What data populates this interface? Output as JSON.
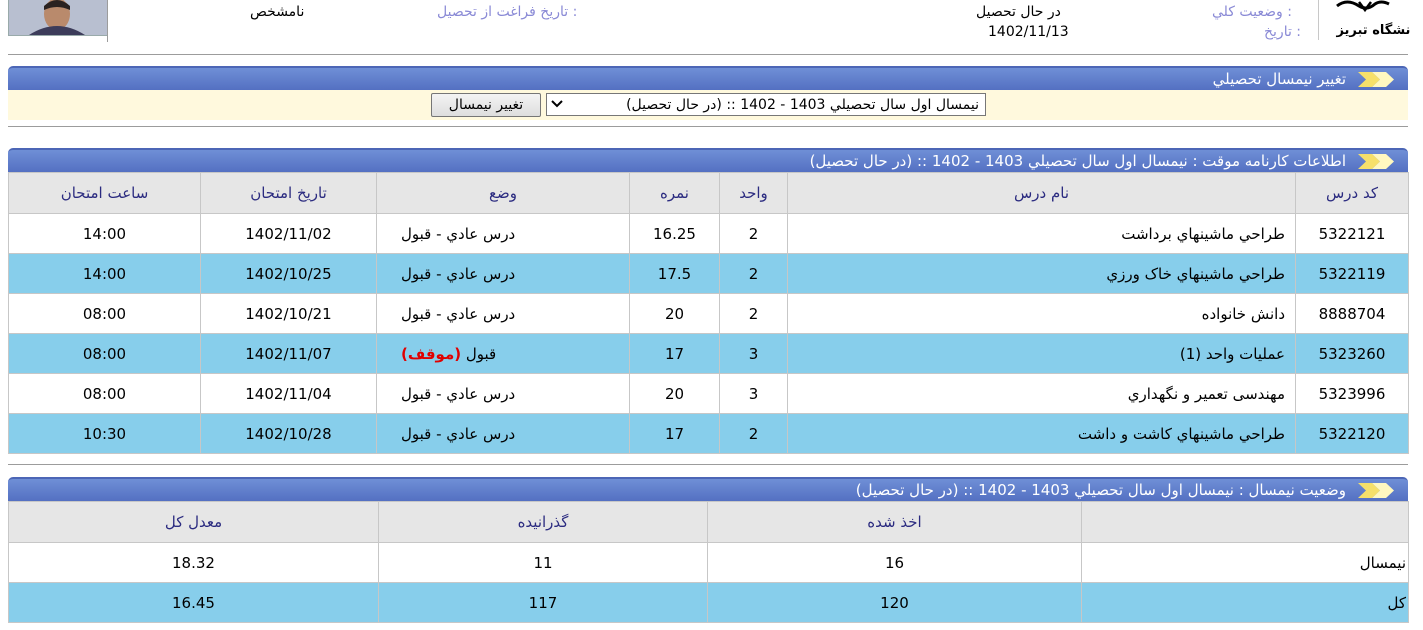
{
  "header": {
    "overall_status_label": "وضعيت کلي :",
    "overall_status_value": "در حال تحصيل",
    "date_label": "تاريخ :",
    "date_value": "1402/11/13",
    "graduation_label": "تاريخ فراغت از تحصيل :",
    "graduation_value": "نامشخص",
    "logo_text": "دانشگاه تبریز"
  },
  "semester_panel": {
    "title": "تغيير نيمسال تحصيلي",
    "selected_option": "نيمسال اول سال تحصيلي 1403 - 1402 :: (در حال تحصيل)",
    "change_button": "تغيير نيمسال"
  },
  "transcript": {
    "title": "اطلاعات کارنامه موقت : نيمسال اول سال تحصيلي 1403 - 1402 :: (در حال تحصيل)",
    "columns": [
      "کد درس",
      "نام درس",
      "واحد",
      "نمره",
      "وضع",
      "تاريخ امتحان",
      "ساعت امتحان"
    ],
    "rows": [
      {
        "code": "5322121",
        "name": "طراحي ماشينهاي برداشت",
        "units": "2",
        "grade": "16.25",
        "status": "درس عادي - قبول",
        "status_extra": "",
        "exam_date": "1402/11/02",
        "exam_time": "14:00"
      },
      {
        "code": "5322119",
        "name": "طراحي ماشينهاي خاک ورزي",
        "units": "2",
        "grade": "17.5",
        "status": "درس عادي - قبول",
        "status_extra": "",
        "exam_date": "1402/10/25",
        "exam_time": "14:00"
      },
      {
        "code": "8888704",
        "name": "دانش خانواده",
        "units": "2",
        "grade": "20",
        "status": "درس عادي - قبول",
        "status_extra": "",
        "exam_date": "1402/10/21",
        "exam_time": "08:00"
      },
      {
        "code": "5323260",
        "name": "عمليات واحد (1)",
        "units": "3",
        "grade": "17",
        "status": "قبول",
        "status_extra": "(موقف)",
        "exam_date": "1402/11/07",
        "exam_time": "08:00"
      },
      {
        "code": "5323996",
        "name": "مهندسی تعمیر و نگهداري",
        "units": "3",
        "grade": "20",
        "status": "درس عادي - قبول",
        "status_extra": "",
        "exam_date": "1402/11/04",
        "exam_time": "08:00"
      },
      {
        "code": "5322120",
        "name": "طراحي ماشينهاي کاشت و داشت",
        "units": "2",
        "grade": "17",
        "status": "درس عادي - قبول",
        "status_extra": "",
        "exam_date": "1402/10/28",
        "exam_time": "10:30"
      }
    ]
  },
  "semester_status": {
    "title": "وضعيت نيمسال : نيمسال اول سال تحصيلي 1403 - 1402 :: (در حال تحصيل)",
    "columns": [
      "",
      "اخذ شده",
      "گذرانيده",
      "معدل کل"
    ],
    "rows": [
      {
        "label": "نيمسال",
        "taken": "16",
        "passed": "11",
        "gpa": "18.32"
      },
      {
        "label": "کل",
        "taken": "120",
        "passed": "117",
        "gpa": "16.45"
      }
    ]
  }
}
